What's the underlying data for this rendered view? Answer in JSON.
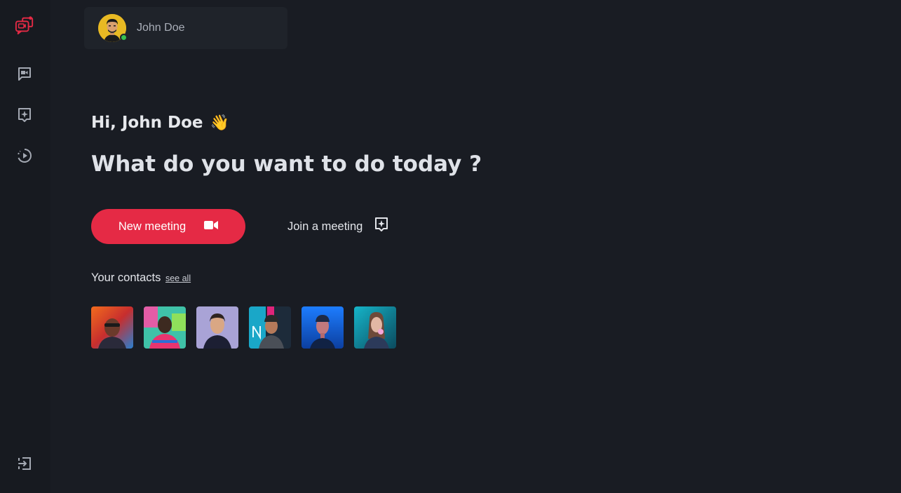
{
  "user": {
    "name": "John Doe",
    "status": "online"
  },
  "sidebar": {
    "items": [
      {
        "icon": "video-chat-logo-icon"
      },
      {
        "icon": "chat-video-icon"
      },
      {
        "icon": "join-plus-icon"
      },
      {
        "icon": "history-play-icon"
      },
      {
        "icon": "logout-icon"
      }
    ]
  },
  "main": {
    "greeting": "Hi, John Doe",
    "greeting_emoji": "👋",
    "headline": "What do you want to do today ?",
    "new_meeting_label": "New meeting",
    "join_meeting_label": "Join a meeting",
    "contacts_title": "Your contacts",
    "see_all_label": "see all"
  },
  "contacts": [
    {
      "name": "contact-1"
    },
    {
      "name": "contact-2"
    },
    {
      "name": "contact-3"
    },
    {
      "name": "contact-4"
    },
    {
      "name": "contact-5"
    },
    {
      "name": "contact-6"
    }
  ],
  "colors": {
    "accent": "#e52a45",
    "background": "#191c23",
    "sidebar": "#171a20",
    "card": "#1f232a",
    "online": "#37c14f"
  }
}
